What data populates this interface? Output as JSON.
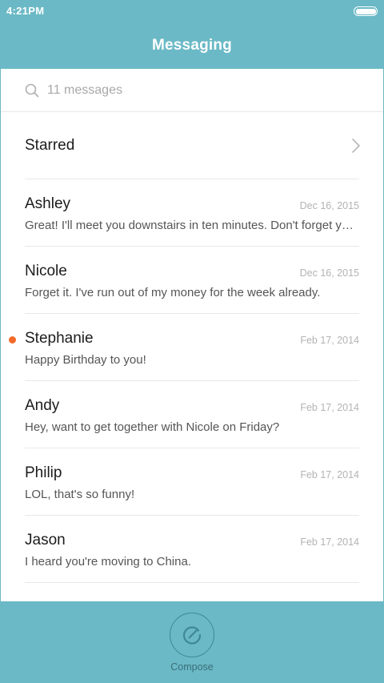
{
  "status_bar": {
    "time": "4:21PM",
    "battery_level": 1.0
  },
  "header": {
    "title": "Messaging"
  },
  "search": {
    "placeholder": "11 messages"
  },
  "starred": {
    "label": "Starred"
  },
  "messages": [
    {
      "name": "Ashley",
      "date": "Dec 16, 2015",
      "preview": "Great! I'll meet you downstairs in ten minutes. Don't forget your umbrella.",
      "unread": false
    },
    {
      "name": "Nicole",
      "date": "Dec 16, 2015",
      "preview": "Forget it. I've run out of my money for the week already.",
      "unread": false
    },
    {
      "name": "Stephanie",
      "date": "Feb 17, 2014",
      "preview": "Happy Birthday to you!",
      "unread": true
    },
    {
      "name": "Andy",
      "date": "Feb 17, 2014",
      "preview": "Hey, want to get together with Nicole on Friday?",
      "unread": false
    },
    {
      "name": "Philip",
      "date": "Feb 17, 2014",
      "preview": "LOL, that's so funny!",
      "unread": false
    },
    {
      "name": "Jason",
      "date": "Feb 17, 2014",
      "preview": "I heard you're moving to China.",
      "unread": false
    }
  ],
  "footer": {
    "compose_label": "Compose",
    "compose_icon": "compose-icon"
  },
  "colors": {
    "accent": "#6bb9c6",
    "unread_dot": "#f26a2a"
  }
}
